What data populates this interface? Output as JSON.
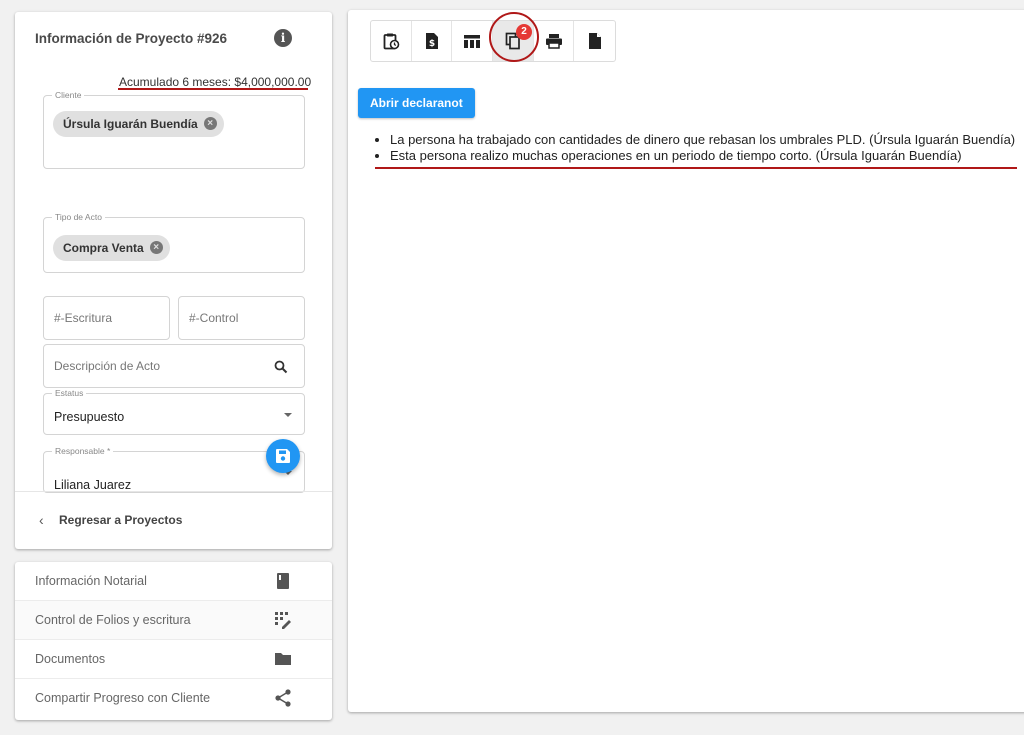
{
  "project": {
    "title": "Información de Proyecto #926",
    "accumulated": "Acumulado 6 meses: $4,000,000.00",
    "cliente": {
      "legend": "Cliente",
      "chip": "Úrsula Iguarán Buendía"
    },
    "tipo_acto": {
      "legend": "Tipo de Acto",
      "chip": "Compra Venta"
    },
    "escritura_placeholder": "#-Escritura",
    "control_placeholder": "#-Control",
    "descripcion_placeholder": "Descripción de Acto",
    "estatus": {
      "legend": "Estatus",
      "value": "Presupuesto"
    },
    "responsable": {
      "legend": "Responsable *",
      "value": "Liliana Juarez"
    },
    "back_label": "Regresar a Proyectos"
  },
  "menu": {
    "items": [
      {
        "label": "Información Notarial",
        "icon": "book-icon"
      },
      {
        "label": "Control de Folios y escritura",
        "icon": "grid-edit-icon"
      },
      {
        "label": "Documentos",
        "icon": "folder-icon"
      },
      {
        "label": "Compartir Progreso con Cliente",
        "icon": "share-icon"
      }
    ]
  },
  "toolbar": {
    "buttons": [
      {
        "icon": "clipboard-clock-icon"
      },
      {
        "icon": "file-dollar-icon"
      },
      {
        "icon": "table-icon"
      },
      {
        "icon": "copy-icon",
        "badge": "2",
        "active": true
      },
      {
        "icon": "print-icon"
      },
      {
        "icon": "file-icon"
      }
    ]
  },
  "main": {
    "open_button": "Abrir declaranot",
    "alerts": [
      "La persona ha trabajado con cantidades de dinero que rebasan los umbrales PLD. (Úrsula Iguarán Buendía)",
      "Esta persona realizo muchas operaciones en un periodo de tiempo corto. (Úrsula Iguarán Buendía)"
    ]
  },
  "colors": {
    "primary": "#2196f3",
    "badge": "#e53935",
    "annotation": "#b01818"
  }
}
